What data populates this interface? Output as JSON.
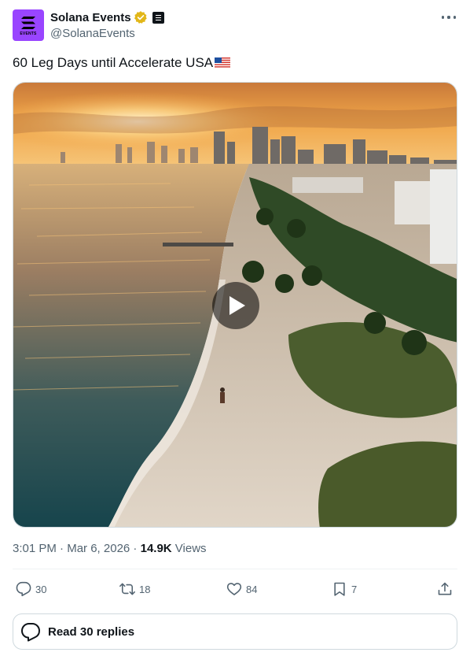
{
  "author": {
    "display_name": "Solana Events",
    "handle": "@SolanaEvents",
    "avatar_text": "EVENTS",
    "avatar_color": "#9945ff",
    "verified_color": "#e2b719"
  },
  "tweet": {
    "text": "60 Leg Days until Accelerate USA",
    "flag_icon": "us-flag-emoji"
  },
  "media": {
    "type": "video",
    "play_icon": "play-icon"
  },
  "meta": {
    "time": "3:01 PM",
    "separator": " · ",
    "date": "Mar 6, 2026",
    "views_count": "14.9K",
    "views_label": " Views"
  },
  "actions": {
    "replies": "30",
    "reposts": "18",
    "likes": "84",
    "bookmarks": "7"
  },
  "read_replies": {
    "label": "Read 30 replies"
  },
  "colors": {
    "text_primary": "#0f1419",
    "text_secondary": "#536471",
    "border": "#cfd9de"
  }
}
